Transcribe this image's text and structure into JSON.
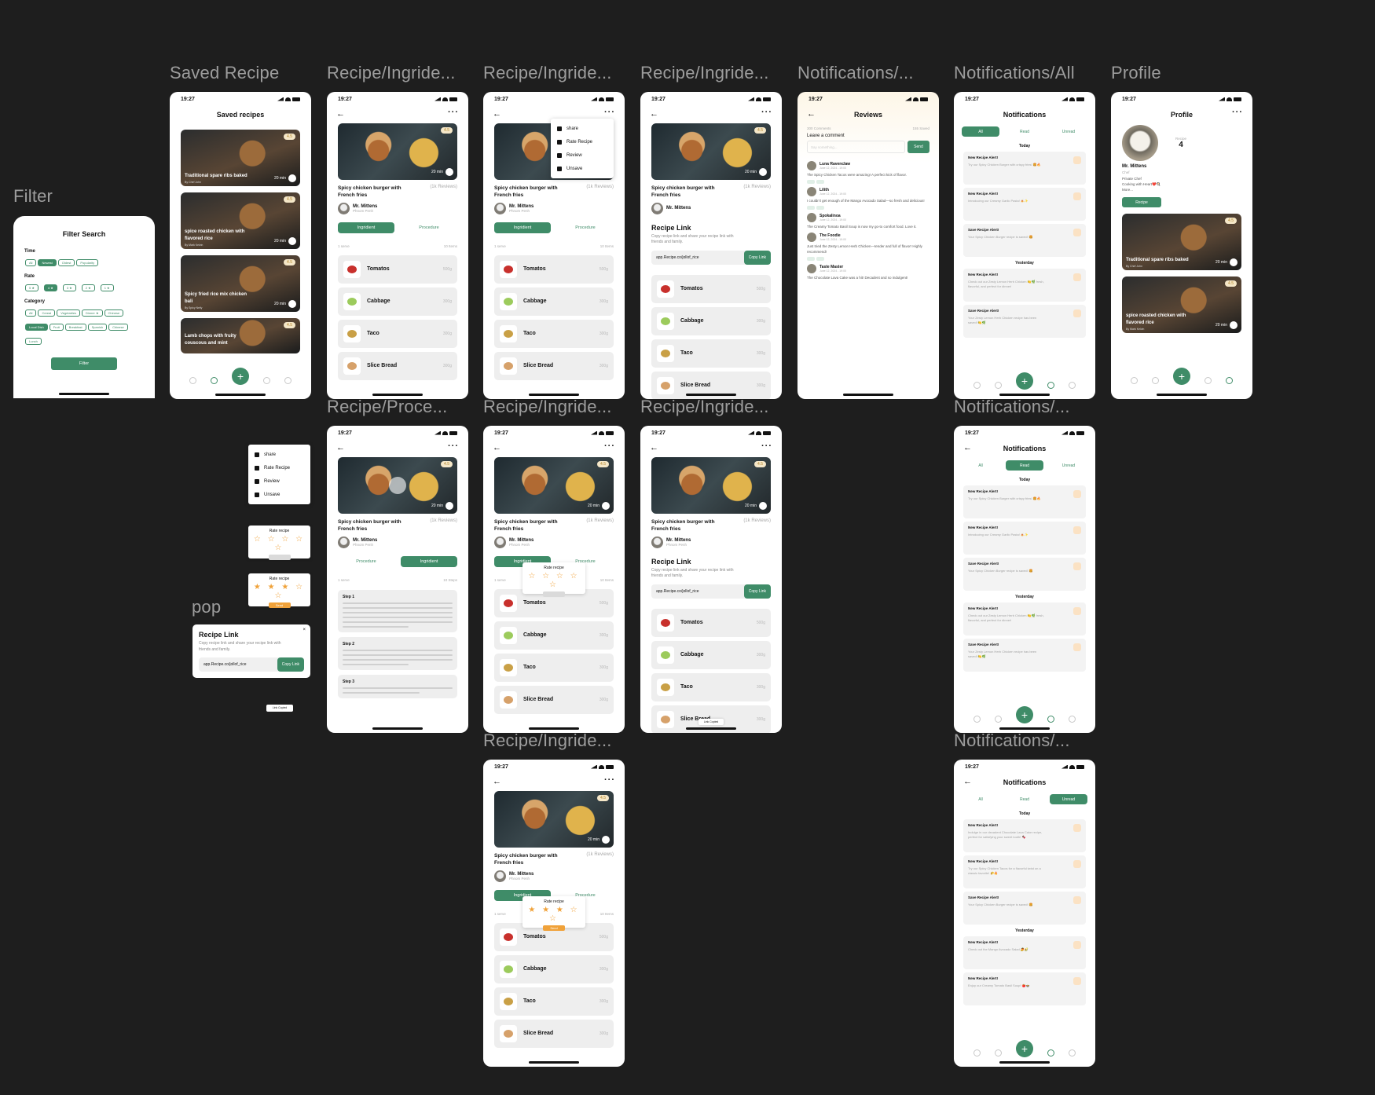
{
  "status_time": "19:27",
  "frame_labels": {
    "filter": "Filter",
    "saved": "Saved Recipe",
    "ing1": "Recipe/Ingride...",
    "ing2": "Recipe/Ingride...",
    "ing3": "Recipe/Ingride...",
    "notif_review": "Notifications/...",
    "notif_all": "Notifications/All",
    "profile": "Profile",
    "proc": "Recipe/Proce...",
    "ing4": "Recipe/Ingride...",
    "ing5": "Recipe/Ingride...",
    "notif_read": "Notifications/...",
    "pop": "pop",
    "ing6": "Recipe/Ingride...",
    "notif_unread": "Notifications/..."
  },
  "recipe": {
    "title": "Spicy chicken burger with French fries",
    "reviews": "(1k Reviews)",
    "author": "Mr. Mittens",
    "location": "Phnom Penh",
    "time": "20 min",
    "rating": "4.5",
    "tab_ingredient": "Ingridient",
    "tab_procedure": "Procedure",
    "serves": "1 serve",
    "item_count": "10 Items",
    "step_count": "10 Steps",
    "ingredients": [
      {
        "name": "Tomatos",
        "qty": "500g",
        "color": "#c8302c"
      },
      {
        "name": "Cabbage",
        "qty": "300g",
        "color": "#9ccb5c"
      },
      {
        "name": "Taco",
        "qty": "300g",
        "color": "#c9a046"
      },
      {
        "name": "Slice Bread",
        "qty": "300g",
        "color": "#d6a16a"
      }
    ],
    "steps": [
      "Step 1",
      "Step 2",
      "Step 3"
    ]
  },
  "menu": {
    "share": "share",
    "rate": "Rate Recipe",
    "review": "Review",
    "unsave": "Unsave"
  },
  "rate_popup": {
    "title": "Rate recipe",
    "empty_stars": "☆ ☆ ☆ ☆ ☆",
    "filled_stars": "★ ★ ★ ☆ ☆",
    "send": "Send"
  },
  "link_popup": {
    "title": "Recipe Link",
    "desc": "Copy recipe link and share your recipe link with friends and family.",
    "url": "app.Recipe.co/jollof_rice",
    "button": "Copy Link",
    "toast": "Link Copied"
  },
  "filter": {
    "title": "Filter Search",
    "time_label": "Time",
    "time_options": [
      "All",
      "Newest",
      "Oldest",
      "Popularity"
    ],
    "rate_label": "Rate",
    "rate_options": [
      "5 ★",
      "4 ★",
      "3 ★",
      "2 ★",
      "1 ★"
    ],
    "category_label": "Category",
    "category_options": [
      "All",
      "Cereal",
      "Vegetables",
      "Dinner ★",
      "Chinese",
      "Local Dish",
      "Fruit",
      "Breakfast",
      "Spanish",
      "Chinese",
      "Lunch"
    ],
    "button": "Filter"
  },
  "saved": {
    "title": "Saved recipes",
    "cards": [
      {
        "title": "Traditional spare ribs baked",
        "by": "By Chef John",
        "time": "20 min"
      },
      {
        "title": "spice roasted chicken with flavored rice",
        "by": "By Mark Kelvin",
        "time": "20 min"
      },
      {
        "title": "Spicy fried rice mix chicken bali",
        "by": "By Spicy Nelly",
        "time": "20 min"
      },
      {
        "title": "Lamb chops with fruity couscous and mint",
        "by": "",
        "time": ""
      }
    ]
  },
  "reviews": {
    "title": "Reviews",
    "comments": "300 Comments",
    "saved": "155 Saved",
    "leave": "Leave a comment",
    "placeholder": "Say something...",
    "send": "Send",
    "items": [
      {
        "name": "Luna Ravenclaw",
        "date": "June 12, 2024 - 19:00",
        "text": "The Spicy Chicken Tacos were amazing! A perfect kick of flavor."
      },
      {
        "name": "Lilith",
        "date": "June 12, 2024 - 19:00",
        "text": "I couldn't get enough of the Mango Avocado Salad—so fresh and delicious!"
      },
      {
        "name": "Spokalinoa",
        "date": "June 12, 2024 - 19:00",
        "text": "The Creamy Tomato Basil Soup is now my go-to comfort food. Love it."
      },
      {
        "name": "The Foodie",
        "date": "June 12, 2024 - 19:00",
        "text": "Just tried the Zesty Lemon Herb Chicken—tender and full of flavor! Highly recommend!"
      },
      {
        "name": "Taste Master",
        "date": "June 12, 2024 - 19:00",
        "text": "The Chocolate Lava Cake was a hit! Decadent and so indulgent!"
      }
    ]
  },
  "notifications": {
    "title": "Notifications",
    "tab_all": "All",
    "tab_read": "Read",
    "tab_unread": "Unread",
    "today": "Today",
    "yesterday": "Yesterday",
    "items": [
      {
        "title": "New Recipe Alert!",
        "body": "Try our Spicy Chicken Burger with crispy fries! 🍔🔥",
        "time": "10 mins ago"
      },
      {
        "title": "New Recipe Alert!",
        "body": "Introducing our Creamy Garlic Pasta! 🍝✨",
        "time": "10 mins ago"
      },
      {
        "title": "Save Recipe Alert!",
        "body": "Your Spicy Chicken Burger recipe is saved! 🍔",
        "time": "10 mins ago"
      },
      {
        "title": "New Recipe Alert!",
        "body": "Check out our Zesty Lemon Herb Chicken 🍋🌿 fresh, flavorful, and perfect for dinner!",
        "time": "10 mins ago"
      },
      {
        "title": "Save Recipe Alert!",
        "body": "Your Zesty Lemon Herb Chicken recipe has been saved! 🍋🌿",
        "time": "10 mins ago"
      }
    ],
    "unread_items": [
      {
        "title": "New Recipe Alert!",
        "body": "Indulge in our decadent Chocolate Lava Cake recipe, perfect for satisfying your sweet tooth! 🍫",
        "time": "10 mins ago"
      },
      {
        "title": "New Recipe Alert!",
        "body": "Try our Spicy Chicken Tacos for a flavorful twist on a classic favorite! 🌮🔥",
        "time": "10 mins ago"
      },
      {
        "title": "Save Recipe Alert!",
        "body": "Your Spicy Chicken Burger recipe is saved! 🍔",
        "time": "10 mins ago"
      },
      {
        "title": "New Recipe Alert!",
        "body": "Check out the Mango Avocado Salad 🥭🥑",
        "time": "10 mins ago"
      },
      {
        "title": "New Recipe Alert!",
        "body": "Enjoy our Creamy Tomato Basil Soup! 🍅🍲",
        "time": "10 mins ago"
      }
    ]
  },
  "profile": {
    "title": "Profile",
    "recipe_label": "Recipe",
    "recipe_count": "4",
    "name": "Mr. Mittens",
    "role": "Chef",
    "bio": "Private Chef\nCooking with Heart❤️🍳\nMore...",
    "tab": "Recipe",
    "cards": [
      {
        "title": "Traditional spare ribs baked",
        "by": "By Chef John",
        "time": "20 min"
      },
      {
        "title": "spice roasted chicken with flavored rice",
        "by": "By Mark Kelvin",
        "time": "20 min"
      }
    ]
  },
  "colors": {
    "primary": "#3f8c68",
    "background": "#1e1e1e",
    "accent": "#f0a23a",
    "card": "#eeeeee"
  }
}
